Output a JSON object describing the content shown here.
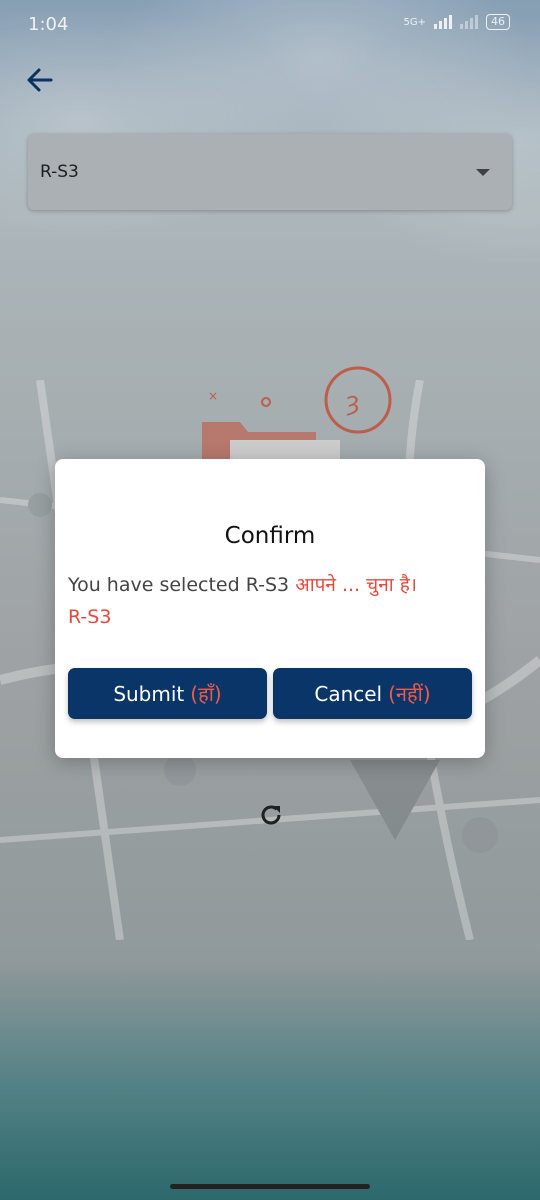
{
  "status_bar": {
    "time": "1:04",
    "network": "5G+",
    "battery": "46"
  },
  "dropdown": {
    "value": "R-S3"
  },
  "dialog": {
    "title": "Confirm",
    "message_en": "You have selected  R-S3",
    "message_hi": "आपने ... चुना है।",
    "selected_value": "R-S3",
    "submit_label": "Submit",
    "submit_hi": "(हाँ)",
    "cancel_label": "Cancel",
    "cancel_hi": "(नहीं)"
  },
  "colors": {
    "primary": "#0a3568",
    "accent_red": "#e44b3e"
  },
  "icons": {
    "back": "arrow-left-icon",
    "dropdown": "caret-down-icon",
    "refresh": "refresh-icon"
  }
}
